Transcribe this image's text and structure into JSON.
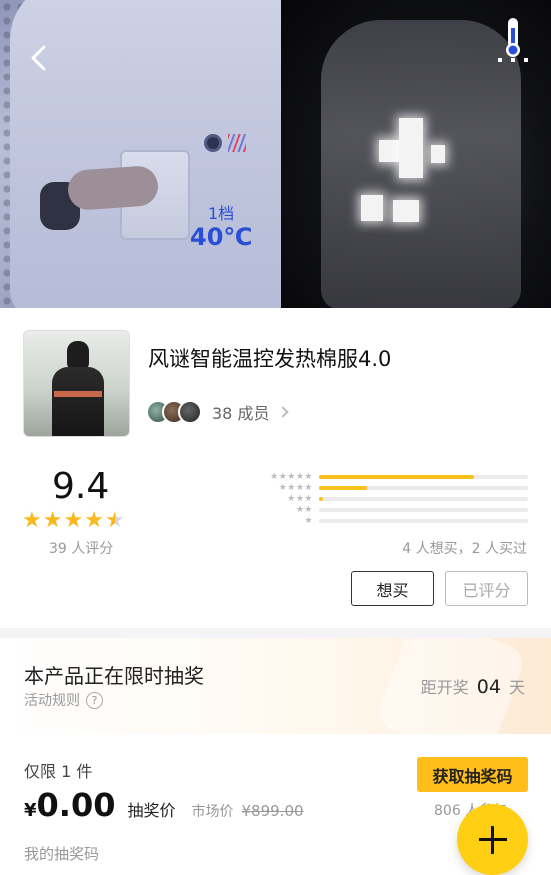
{
  "hero": {
    "level_text": "1档",
    "temp_text": "40℃",
    "back_icon": "back-arrow-icon",
    "thermo_icon": "thermometer-icon"
  },
  "product": {
    "title": "风谜智能温控发热棉服4.0",
    "members_count": "38 成员"
  },
  "rating": {
    "score": "9.4",
    "stars": 4.5,
    "count_text": "39 人评分",
    "distribution": [
      {
        "stars": 5,
        "fraction": 0.74
      },
      {
        "stars": 4,
        "fraction": 0.23
      },
      {
        "stars": 3,
        "fraction": 0.02
      },
      {
        "stars": 2,
        "fraction": 0.0
      },
      {
        "stars": 1,
        "fraction": 0.0
      }
    ],
    "want_summary": "4 人想买，2 人买过"
  },
  "actions": {
    "want_label": "想买",
    "rated_label": "已评分"
  },
  "lottery": {
    "title": "本产品正在限时抽奖",
    "rules_label": "活动规则",
    "countdown_label": "距开奖",
    "countdown_value": "04",
    "countdown_unit": "天",
    "limit_text": "仅限 1 件",
    "price_symbol": "¥",
    "price_value": "0.00",
    "price_label": "抽奖价",
    "market_label": "市场价",
    "market_value": "¥899.00",
    "get_code_label": "获取抽奖码",
    "people_text": "806 人参与",
    "my_code_label": "我的抽奖码"
  },
  "colors": {
    "accent": "#ffbe1a",
    "fab": "#ffcf14",
    "star": "#f8b920",
    "temp_blue": "#2a4fd6"
  }
}
